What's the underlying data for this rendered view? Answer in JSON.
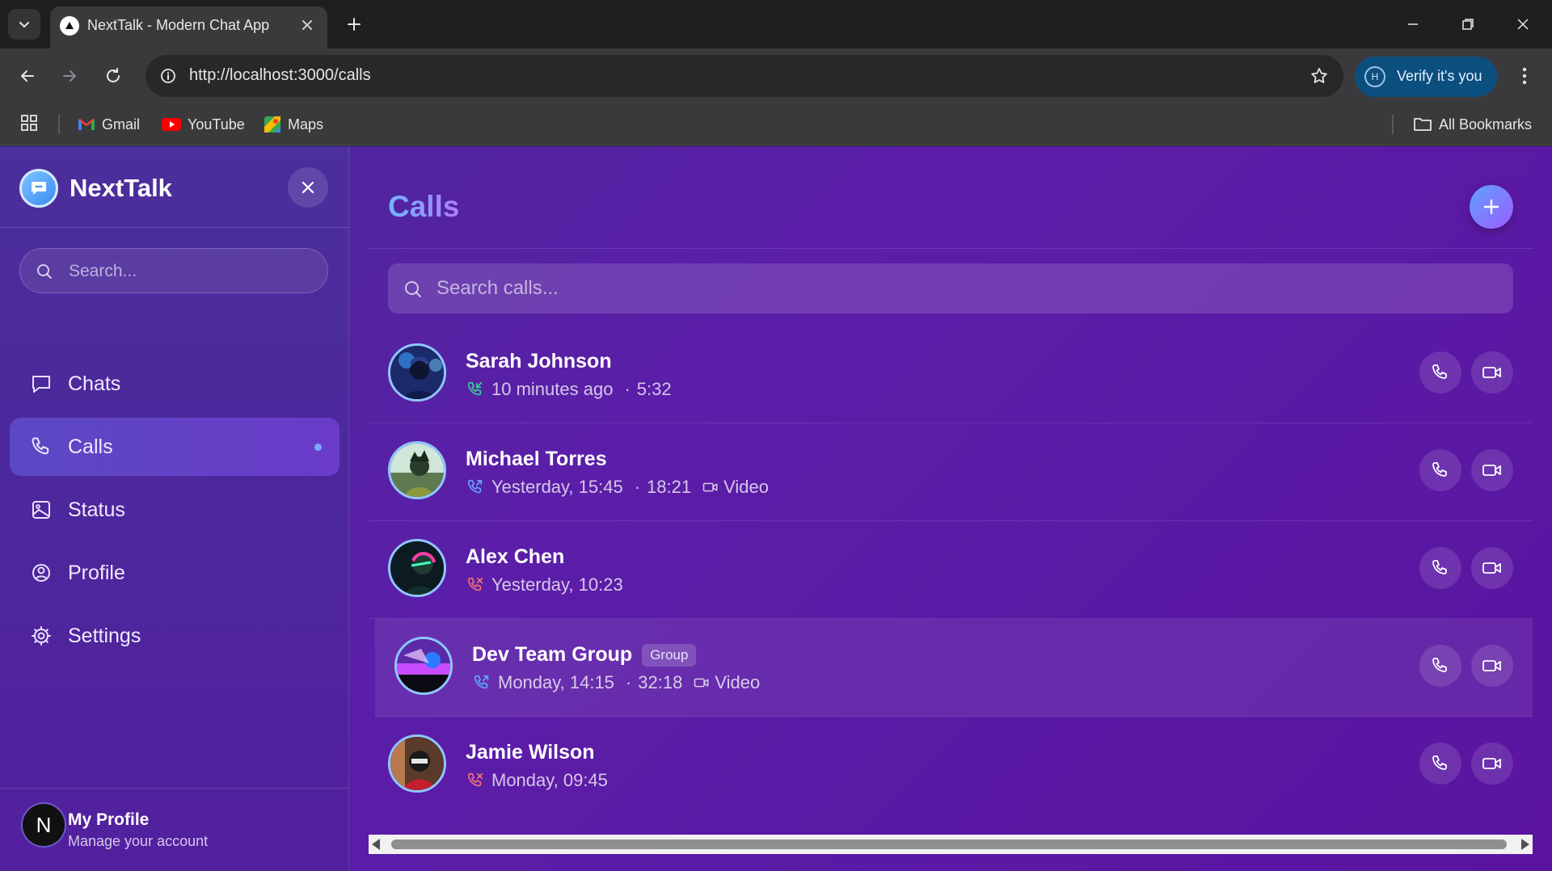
{
  "browser": {
    "tab_title": "NextTalk - Modern Chat App",
    "url": "http://localhost:3000/calls",
    "verify_label": "Verify it's you",
    "verify_avatar_letter": "H",
    "bookmarks": [
      {
        "label": "Gmail",
        "icon": "gmail-icon"
      },
      {
        "label": "YouTube",
        "icon": "youtube-icon"
      },
      {
        "label": "Maps",
        "icon": "maps-icon"
      }
    ],
    "all_bookmarks_label": "All Bookmarks"
  },
  "sidebar": {
    "brand": "NextTalk",
    "search_placeholder": "Search...",
    "nav": [
      {
        "label": "Chats",
        "icon": "chat-bubble-icon",
        "active": false
      },
      {
        "label": "Calls",
        "icon": "phone-icon",
        "active": true
      },
      {
        "label": "Status",
        "icon": "image-icon",
        "active": false
      },
      {
        "label": "Profile",
        "icon": "user-circle-icon",
        "active": false
      },
      {
        "label": "Settings",
        "icon": "gear-icon",
        "active": false
      }
    ],
    "profile": {
      "avatar_letter": "N",
      "name": "My Profile",
      "subtitle": "Manage your account"
    }
  },
  "main": {
    "title": "Calls",
    "search_placeholder": "Search calls...",
    "calls": [
      {
        "name": "Sarah Johnson",
        "status": "incoming",
        "time": "10 minutes ago",
        "duration": "5:32",
        "video": false,
        "group": false
      },
      {
        "name": "Michael Torres",
        "status": "outgoing",
        "time": "Yesterday, 15:45",
        "duration": "18:21",
        "video": true,
        "group": false
      },
      {
        "name": "Alex Chen",
        "status": "missed",
        "time": "Yesterday, 10:23",
        "duration": "",
        "video": false,
        "group": false
      },
      {
        "name": "Dev Team Group",
        "status": "outgoing",
        "time": "Monday, 14:15",
        "duration": "32:18",
        "video": true,
        "group": true
      },
      {
        "name": "Jamie Wilson",
        "status": "missed",
        "time": "Monday, 09:45",
        "duration": "",
        "video": false,
        "group": false
      }
    ],
    "video_label": "Video",
    "group_label": "Group",
    "duration_separator": "·"
  },
  "colors": {
    "incoming": "#34d399",
    "outgoing": "#60a5fa",
    "missed": "#f87171",
    "accent": "#7aa6ff"
  }
}
